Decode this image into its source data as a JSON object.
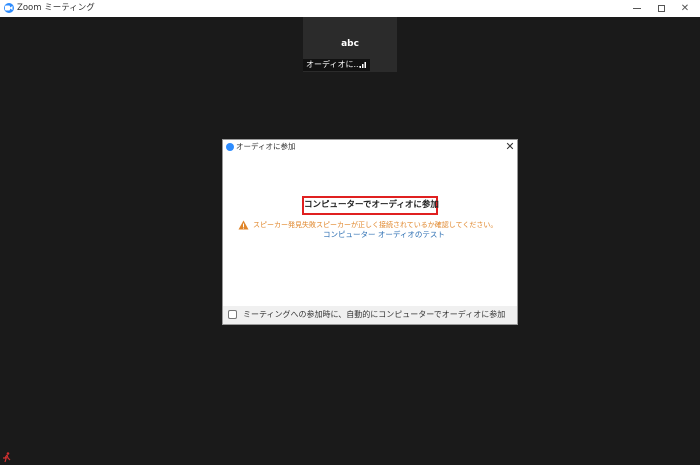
{
  "window": {
    "title": "Zoom ミーティング",
    "controls": {
      "minimize_icon": "minimize-icon",
      "maximize_icon": "maximize-icon",
      "close_icon": "close-icon"
    }
  },
  "participant": {
    "name": "abc",
    "label": "オーディオに...",
    "signal_icon": "signal-icon"
  },
  "dialog": {
    "title": "オーディオに参加",
    "close_icon": "close-icon",
    "join_button_label": "コンピューターでオーディオに参加",
    "warning_icon": "warning-icon",
    "warning_text": "スピーカー発見失敗スピーカーが正しく接続されているか確認してください。",
    "test_link": "コンピューター オーディオのテスト",
    "auto_join_label": "ミーティングへの参加時に、自動的にコンピューターでオーディオに参加",
    "auto_join_checked": false
  },
  "colors": {
    "background": "#1a1a1a",
    "accent": "#2d8cff",
    "warning": "#e0862a",
    "link": "#2d6fb3",
    "highlight_border": "#e02020"
  }
}
